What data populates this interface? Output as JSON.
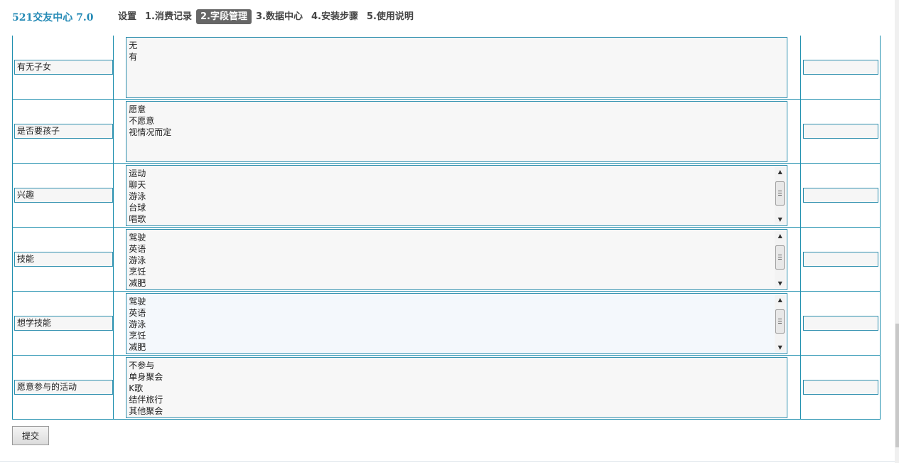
{
  "header": {
    "brand": "521交友中心 7.0",
    "nav": [
      {
        "label": "设置",
        "active": false
      },
      {
        "label": "1.消费记录",
        "active": false
      },
      {
        "label": "2.字段管理",
        "active": true
      },
      {
        "label": "3.数据中心",
        "active": false
      },
      {
        "label": "4.安装步骤",
        "active": false
      },
      {
        "label": "5.使用说明",
        "active": false
      }
    ]
  },
  "fields": [
    {
      "label": "有无子女",
      "options": [
        "无",
        "有"
      ],
      "scrollable": false
    },
    {
      "label": "是否要孩子",
      "options": [
        "愿意",
        "不愿意",
        "视情况而定"
      ],
      "scrollable": false
    },
    {
      "label": "兴趣",
      "options": [
        "运动",
        "聊天",
        "游泳",
        "台球",
        "唱歌"
      ],
      "scrollable": true
    },
    {
      "label": "技能",
      "options": [
        "驾驶",
        "英语",
        "游泳",
        "烹饪",
        "减肥"
      ],
      "scrollable": true
    },
    {
      "label": "想学技能",
      "options": [
        "驾驶",
        "英语",
        "游泳",
        "烹饪",
        "减肥"
      ],
      "scrollable": true
    },
    {
      "label": "愿意参与的活动",
      "options": [
        "不参与",
        "单身聚会",
        "K歌",
        "结伴旅行",
        "其他聚会"
      ],
      "scrollable": false
    }
  ],
  "form": {
    "submit_label": "提交"
  },
  "colors": {
    "brand": "#2389b5",
    "border": "#1f8fae",
    "active_tab_bg": "#666666"
  }
}
